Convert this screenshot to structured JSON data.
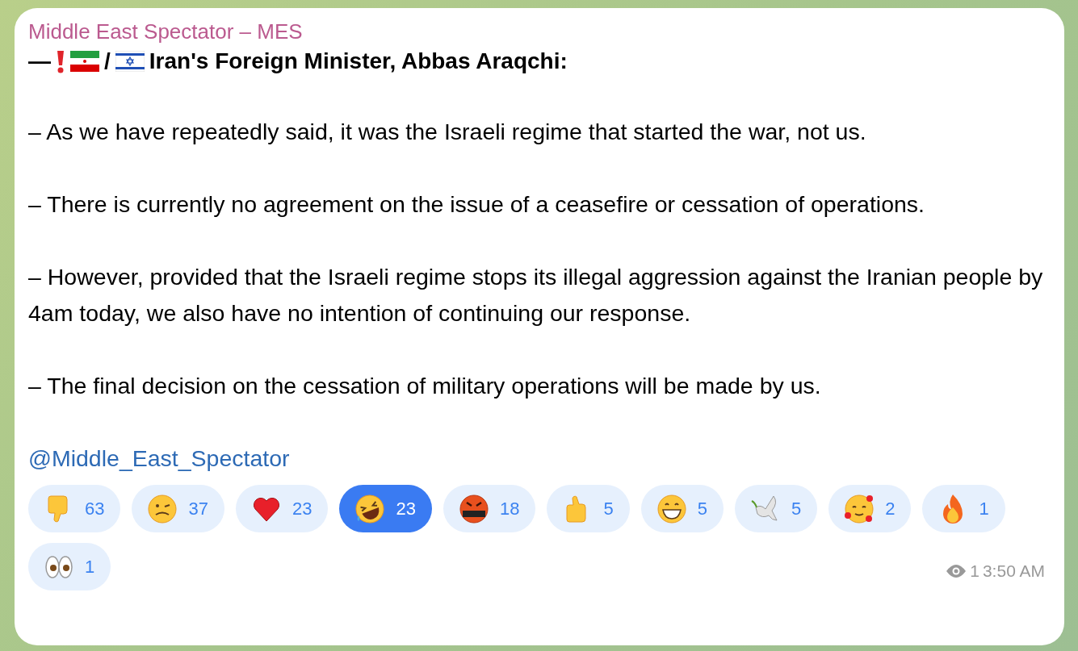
{
  "message": {
    "channel": "Middle East Spectator – MES",
    "header": {
      "dash": "—",
      "separator": "/",
      "title": "Iran's Foreign Minister, Abbas Araqchi:"
    },
    "paragraphs": [
      "– As we have repeatedly said, it was the Israeli regime that started the war, not us.",
      "– There is currently no agreement on the issue of a ceasefire or cessation of operations.",
      "– However, provided that the Israeli regime stops its illegal aggression against the Iranian people by 4am today, we also have no intention of continuing our response.",
      "– The final decision on the cessation of military operations will be made by us."
    ],
    "mention": "@Middle_East_Spectator",
    "reactions": [
      {
        "kind": "thumbs-down",
        "count": "63",
        "selected": false
      },
      {
        "kind": "woozy",
        "count": "37",
        "selected": false
      },
      {
        "kind": "heart",
        "count": "23",
        "selected": false
      },
      {
        "kind": "rofl",
        "count": "23",
        "selected": true
      },
      {
        "kind": "cursing",
        "count": "18",
        "selected": false
      },
      {
        "kind": "thumbs-up",
        "count": "5",
        "selected": false
      },
      {
        "kind": "grin",
        "count": "5",
        "selected": false
      },
      {
        "kind": "dove",
        "count": "5",
        "selected": false
      },
      {
        "kind": "hearts-face",
        "count": "2",
        "selected": false
      },
      {
        "kind": "fire",
        "count": "1",
        "selected": false
      },
      {
        "kind": "eyes",
        "count": "1",
        "selected": false
      }
    ],
    "views": "1",
    "time": "3:50 AM"
  }
}
